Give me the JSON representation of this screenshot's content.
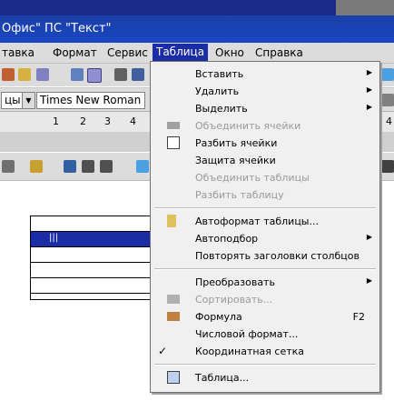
{
  "window": {
    "title": "Офис\" ПС \"Текст\""
  },
  "menubar": {
    "items": [
      {
        "label": "тавка"
      },
      {
        "label": "Формат"
      },
      {
        "label": "Сервис"
      },
      {
        "label": "Таблица"
      },
      {
        "label": "Окно"
      },
      {
        "label": "Справка"
      }
    ]
  },
  "toolbar": {
    "style_value": "цы",
    "font_value": "Times New Roman",
    "right_value": "4"
  },
  "ruler": {
    "ticks": [
      "1",
      "2",
      "3",
      "4"
    ]
  },
  "table": {
    "selected_row_text": "|||"
  },
  "menu": {
    "items": [
      {
        "label": "Вставить",
        "arrow": "▶"
      },
      {
        "label": "Удалить",
        "arrow": "▶"
      },
      {
        "label": "Выделить",
        "arrow": "▶"
      },
      {
        "label": "Объединить ячейки"
      },
      {
        "label": "Разбить ячейки"
      },
      {
        "label": "Защита ячейки"
      },
      {
        "label": "Объединить таблицы"
      },
      {
        "label": "Разбить таблицу"
      },
      {
        "label": "Автоформат таблицы..."
      },
      {
        "label": "Автоподбор",
        "arrow": "▶"
      },
      {
        "label": "Повторять заголовки столбцов"
      },
      {
        "label": "Преобразовать",
        "arrow": "▶"
      },
      {
        "label": "Сортировать..."
      },
      {
        "label": "Формула",
        "shortcut": "F2"
      },
      {
        "label": "Числовой формат..."
      },
      {
        "label": "Координатная сетка",
        "check": "✓"
      },
      {
        "label": "Таблица..."
      }
    ]
  },
  "colors": {
    "accent": "#1a2da6",
    "menu_bg": "#f0f0f0",
    "disabled": "#9a9a9a"
  }
}
